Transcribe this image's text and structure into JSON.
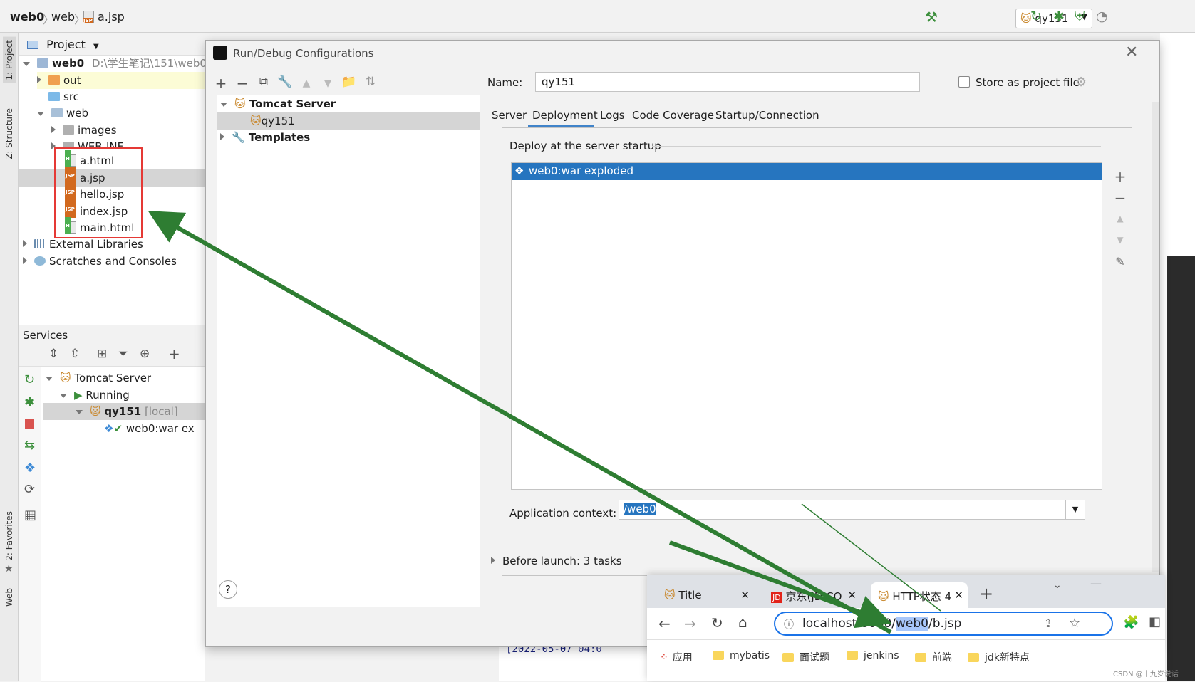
{
  "breadcrumb": {
    "project": "web0",
    "folder": "web",
    "file": "a.jsp"
  },
  "run_config": {
    "selected": "qy151"
  },
  "left_strip": {
    "project_tab": "1: Project",
    "structure_tab": "Z: Structure",
    "favorites_tab": "2: Favorites",
    "web_tab": "Web"
  },
  "project_panel": {
    "title": "Project",
    "root": {
      "name": "web0",
      "path": "D:\\学生笔记\\151\\web0"
    },
    "items": [
      {
        "label": "out"
      },
      {
        "label": "src"
      },
      {
        "label": "web"
      },
      {
        "label": "images"
      },
      {
        "label": "WEB-INF"
      },
      {
        "label": "a.html",
        "type": "H"
      },
      {
        "label": "a.jsp",
        "type": "JSP"
      },
      {
        "label": "hello.jsp",
        "type": "JSP"
      },
      {
        "label": "index.jsp",
        "type": "JSP"
      },
      {
        "label": "main.html",
        "type": "H"
      },
      {
        "label": "External Libraries"
      },
      {
        "label": "Scratches and Consoles"
      }
    ]
  },
  "services_panel": {
    "title": "Services",
    "server": "Tomcat Server",
    "status": "Running",
    "instance": "qy151",
    "instance_suffix": "[local]",
    "artifact": "web0:war ex"
  },
  "dialog": {
    "title": "Run/Debug Configurations",
    "tree": {
      "server": "Tomcat Server",
      "config": "qy151",
      "templates": "Templates"
    },
    "name_label": "Name:",
    "name_value": "qy151",
    "store_label": "Store as project file",
    "tabs": [
      "Server",
      "Deployment",
      "Logs",
      "Code Coverage",
      "Startup/Connection"
    ],
    "active_tab": "Deployment",
    "deploy_heading": "Deploy at the server startup",
    "deploy_item": "web0:war exploded",
    "app_context_label": "Application context:",
    "app_context_value": "/web0",
    "before_launch": "Before launch: 3 tasks",
    "help": "?"
  },
  "browser": {
    "tabs": [
      {
        "title": "Title"
      },
      {
        "title": "京东(JD.CO"
      },
      {
        "title": "HTTP状态 4"
      }
    ],
    "url": {
      "host": "localhost:8080/",
      "highlight": "web0",
      "rest": "/b.jsp"
    },
    "bookmarks": [
      "应用",
      "mybatis",
      "面试题",
      "jenkins",
      "前端",
      "jdk新特点"
    ]
  },
  "console_snippet": "[2022-05-07 04:0",
  "watermark": "CSDN @十九岁说话",
  "colors": {
    "selection": "#2675bf",
    "red_box": "#e53935",
    "arrow": "#2e7d32",
    "link_blue": "#1a73e8"
  }
}
